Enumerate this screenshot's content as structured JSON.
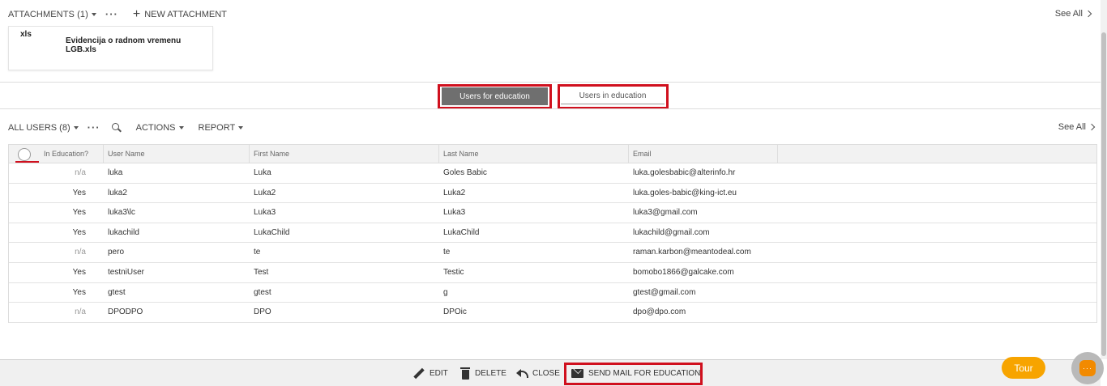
{
  "attachments": {
    "title": "ATTACHMENTS (1)",
    "new_label": "NEW ATTACHMENT",
    "see_all": "See All",
    "file": {
      "extension": "xls",
      "name": "Evidencija o radnom vremenu LGB.xls"
    }
  },
  "tabs": [
    {
      "label": "Users for education",
      "active": true
    },
    {
      "label": "Users in education",
      "active": false
    }
  ],
  "users_toolbar": {
    "title": "ALL USERS (8)",
    "actions_label": "ACTIONS",
    "report_label": "REPORT",
    "see_all": "See All"
  },
  "table": {
    "columns": [
      "In Education?",
      "User Name",
      "First Name",
      "Last Name",
      "Email"
    ],
    "rows": [
      {
        "in_education": "n/a",
        "user_name": "luka",
        "first_name": "Luka",
        "last_name": "Goles Babic",
        "email": "luka.golesbabic@alterinfo.hr"
      },
      {
        "in_education": "Yes",
        "user_name": "luka2",
        "first_name": "Luka2",
        "last_name": "Luka2",
        "email": "luka.goles-babic@king-ict.eu"
      },
      {
        "in_education": "Yes",
        "user_name": "luka3\\lc",
        "first_name": "Luka3",
        "last_name": "Luka3",
        "email": "luka3@gmail.com"
      },
      {
        "in_education": "Yes",
        "user_name": "lukachild",
        "first_name": "LukaChild",
        "last_name": "LukaChild",
        "email": "lukachild@gmail.com"
      },
      {
        "in_education": "n/a",
        "user_name": "pero",
        "first_name": "te",
        "last_name": "te",
        "email": "raman.karbon@meantodeal.com"
      },
      {
        "in_education": "Yes",
        "user_name": "testniUser",
        "first_name": "Test",
        "last_name": "Testic",
        "email": "bomobo1866@galcake.com"
      },
      {
        "in_education": "Yes",
        "user_name": "gtest",
        "first_name": "gtest",
        "last_name": "g",
        "email": "gtest@gmail.com"
      },
      {
        "in_education": "n/a",
        "user_name": "DPODPO",
        "first_name": "DPO",
        "last_name": "DPOic",
        "email": "dpo@dpo.com"
      }
    ]
  },
  "bottom_bar": {
    "edit": "EDIT",
    "delete": "DELETE",
    "close": "CLOSE",
    "send_mail": "SEND MAIL FOR EDUCATION"
  },
  "tour": {
    "label": "Tour"
  },
  "colors": {
    "accent_orange": "#f7a400",
    "highlight_red": "#d0101e",
    "active_tab": "#6f6f6f"
  }
}
